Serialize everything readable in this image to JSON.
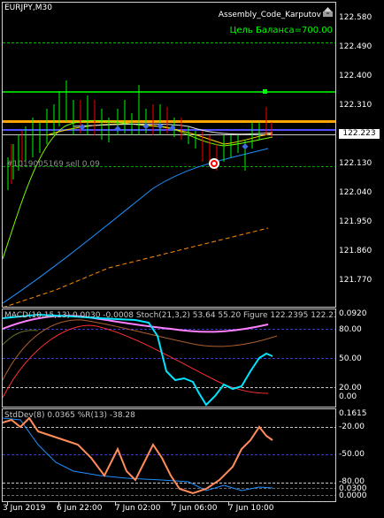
{
  "chart": {
    "symbol_tf": "EURJPY,M30",
    "ea_name": "Assembly_Code_Karputov",
    "balance_target": "Цель Баланса=700.00",
    "order_label": "#1019005169 sell 0.09",
    "price_badge": "122.223",
    "price_axis": [
      "122.580",
      "122.490",
      "122.400",
      "122.310",
      "122.130",
      "122.040",
      "121.950",
      "121.860",
      "121.770"
    ]
  },
  "macd_panel": {
    "label": "MACD(10,15,13) 0.0030 -0.0008 Stoch(21,3,2) 53.64 55.20 Figure 122.2395 122.2376 122",
    "axis": [
      "0.0920",
      "80.00",
      "50.00",
      "20.00",
      "0.00"
    ]
  },
  "std_panel": {
    "label": "StdDev(8) 0.0365 %R(13) -38.28",
    "axis": [
      "0.1615",
      "-20.00",
      "-50.00",
      "-80.00",
      "0.0300",
      "0.0000"
    ]
  },
  "time_axis": [
    "3 Jun 2019",
    "6 Jun 22:00",
    "7 Jun 02:00",
    "7 Jun 06:00",
    "7 Jun 10:00"
  ],
  "colors": {
    "background": "#000000",
    "up_candle": "#00ff00",
    "down_candle": "#ff0000",
    "target_line": "#ffa500",
    "balance_text": "#00ff00",
    "stoch_main": "#00e5ff",
    "stoch_signal": "#ff6347",
    "wpr": "#ff8c5a",
    "stddev": "#1e90ff"
  }
}
